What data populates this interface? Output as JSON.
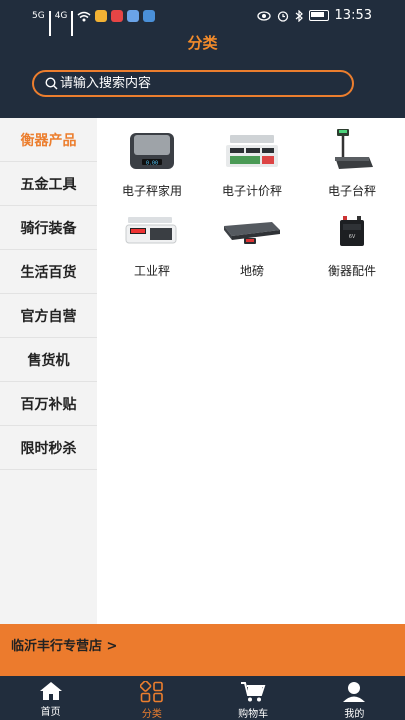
{
  "status_bar": {
    "time": "13:53",
    "signal_1": "5G",
    "signal_2": "4G"
  },
  "header": {
    "title": "分类"
  },
  "search": {
    "placeholder": "请输入搜索内容"
  },
  "sidebar": {
    "active_index": 0,
    "items": [
      {
        "label": "衡器产品"
      },
      {
        "label": "五金工具"
      },
      {
        "label": "骑行装备"
      },
      {
        "label": "生活百货"
      },
      {
        "label": "官方自营"
      },
      {
        "label": "售货机"
      },
      {
        "label": "百万补贴"
      },
      {
        "label": "限时秒杀"
      }
    ]
  },
  "products": [
    {
      "label": "电子秤家用",
      "icon": "household-scale-icon"
    },
    {
      "label": "电子计价秤",
      "icon": "price-computing-scale-icon"
    },
    {
      "label": "电子台秤",
      "icon": "platform-scale-icon"
    },
    {
      "label": "工业秤",
      "icon": "industrial-scale-icon"
    },
    {
      "label": "地磅",
      "icon": "floor-scale-icon"
    },
    {
      "label": "衡器配件",
      "icon": "battery-icon"
    }
  ],
  "banner": {
    "text": "临沂丰行专营店 >"
  },
  "tabbar": {
    "active_index": 1,
    "items": [
      {
        "label": "首页",
        "icon": "home-icon"
      },
      {
        "label": "分类",
        "icon": "category-icon"
      },
      {
        "label": "购物车",
        "icon": "cart-icon"
      },
      {
        "label": "我的",
        "icon": "profile-icon"
      }
    ]
  },
  "colors": {
    "header_bg": "#212d3d",
    "accent": "#ec7e2e",
    "sidebar_bg": "#f3f3f3"
  }
}
